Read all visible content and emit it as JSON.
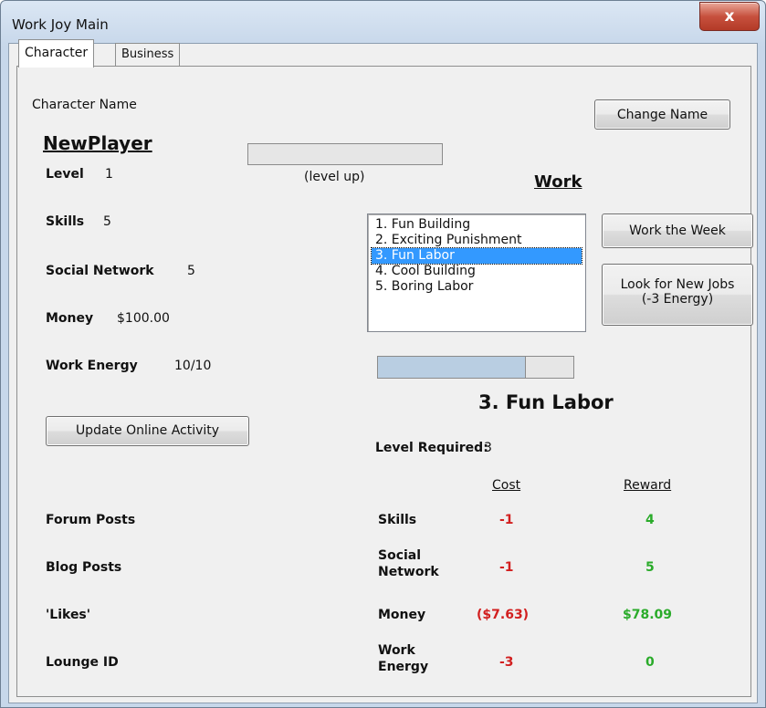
{
  "window": {
    "title": "Work Joy Main",
    "close_label": "x"
  },
  "tabs": [
    {
      "label": "Character"
    },
    {
      "label": "Business"
    }
  ],
  "character": {
    "name_label": "Character Name",
    "name": "NewPlayer",
    "change_name_label": "Change Name",
    "level_label": "Level",
    "level_value": "1",
    "level_progress": 0,
    "level_up_label": "(level up)",
    "skills_label": "Skills",
    "skills_value": "5",
    "social_label": "Social Network",
    "social_value": "5",
    "money_label": "Money",
    "money_value": "$100.00",
    "energy_label": "Work Energy",
    "energy_value": "10/10",
    "update_label": "Update Online Activity",
    "forum_label": "Forum Posts",
    "blog_label": "Blog Posts",
    "likes_label": "'Likes'",
    "lounge_label": "Lounge ID"
  },
  "work": {
    "heading": "Work",
    "jobs": [
      "1. Fun Building",
      "2. Exciting Punishment",
      "3. Fun Labor",
      "4. Cool Building",
      "5. Boring Labor"
    ],
    "selected_index": 2,
    "work_week_label": "Work the Week",
    "look_jobs_line1": "Look for New Jobs",
    "look_jobs_line2": "(-3 Energy)",
    "energy_progress": 0.75,
    "selected_title": "3. Fun Labor",
    "level_required_label": "Level Required:",
    "level_required_value": "3",
    "cost_header": "Cost",
    "reward_header": "Reward",
    "rows": [
      {
        "label": "Skills",
        "cost": "-1",
        "reward": "4"
      },
      {
        "label_line1": "Social",
        "label_line2": "Network",
        "cost": "-1",
        "reward": "5"
      },
      {
        "label": "Money",
        "cost": "($7.63)",
        "reward": "$78.09"
      },
      {
        "label_line1": "Work",
        "label_line2": "Energy",
        "cost": "-3",
        "reward": "0"
      }
    ]
  },
  "colors": {
    "cost": "#d21f1f",
    "reward": "#2aab2a",
    "selection": "#3399ff"
  }
}
